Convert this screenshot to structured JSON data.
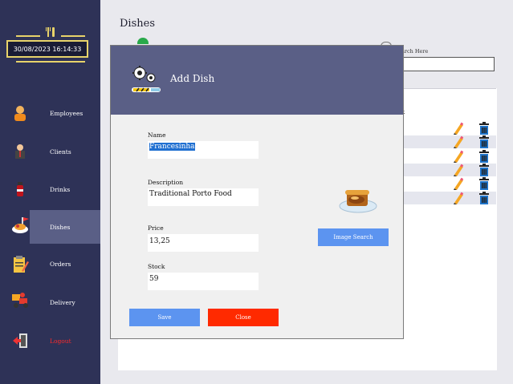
{
  "sidebar": {
    "clock": "30/08/2023 16:14:33",
    "items": [
      {
        "label": "Employees",
        "icon": "employee-icon"
      },
      {
        "label": "Clients",
        "icon": "client-icon"
      },
      {
        "label": "Drinks",
        "icon": "drink-icon"
      },
      {
        "label": "Dishes",
        "icon": "dish-icon"
      },
      {
        "label": "Orders",
        "icon": "orders-icon"
      },
      {
        "label": "Delivery",
        "icon": "delivery-icon"
      },
      {
        "label": "Logout",
        "icon": "logout-icon"
      }
    ],
    "active_item": "Dishes"
  },
  "main": {
    "title": "Dishes",
    "search_label": "arch Here",
    "column_header": "k",
    "rows": 6
  },
  "modal": {
    "title": "Add Dish",
    "name_label": "Name",
    "name_value": "Francesinha",
    "description_label": "Description",
    "description_value": "Traditional Porto Food",
    "price_label": "Price",
    "price_value": "13,25",
    "stock_label": "Stock",
    "stock_value": "59",
    "image_search_label": "Image Search",
    "save_label": "Save",
    "close_label": "Close"
  },
  "colors": {
    "sidebar": "#2e3257",
    "header": "#5a5f86",
    "accent_yellow": "#e8d36a",
    "save_blue": "#5c94f0",
    "close_red": "#ff2a00",
    "logout_red": "#ff2a2a"
  }
}
